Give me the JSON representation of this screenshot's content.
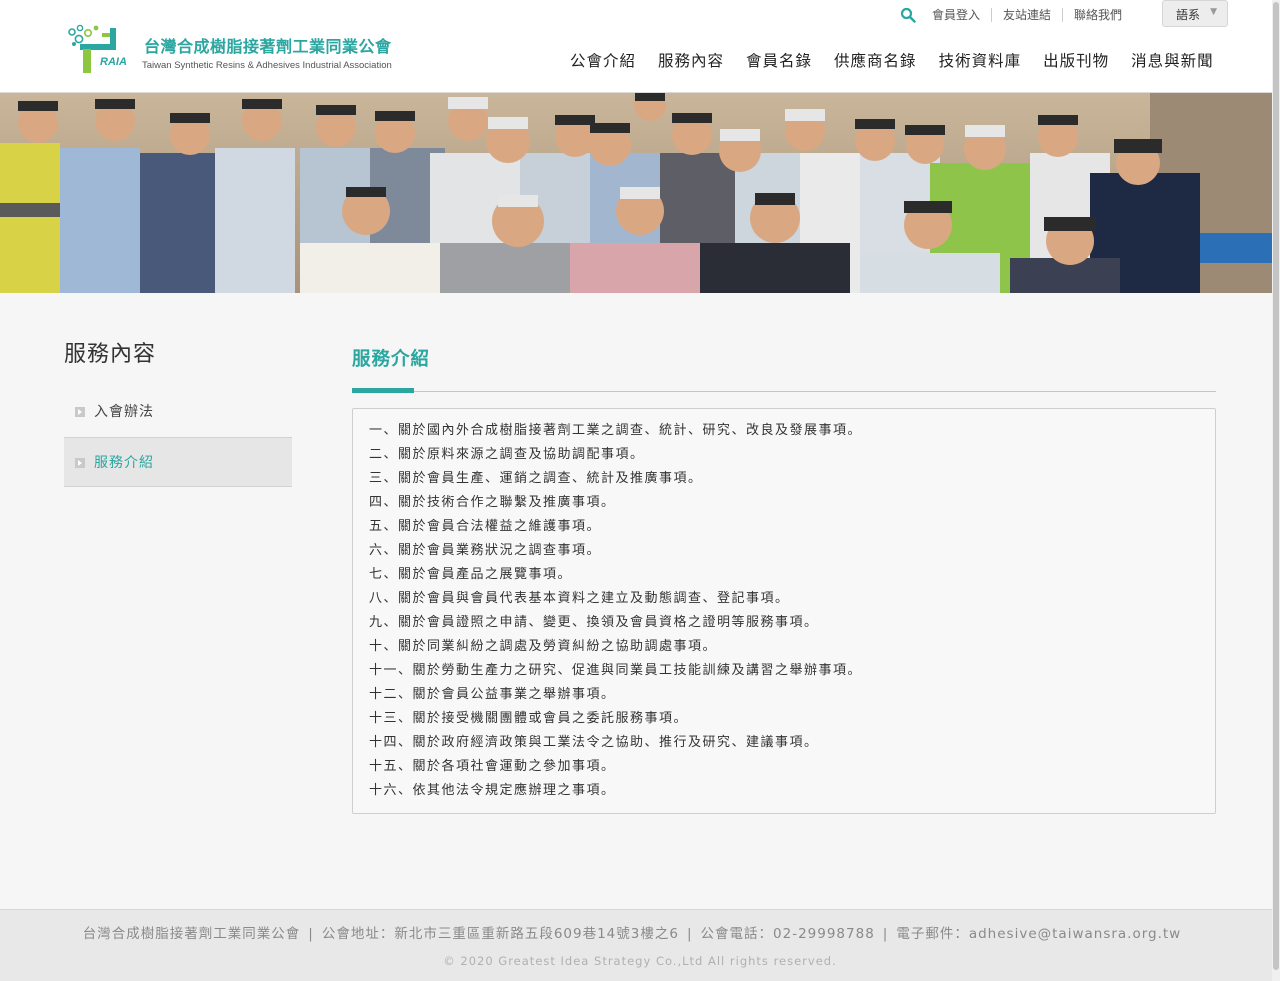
{
  "header": {
    "logo_cn": "台灣合成樹脂接著劑工業同業公會",
    "logo_en": "Taiwan Synthetic Resins & Adhesives Industrial Association",
    "logo_abbr": "RAIA",
    "util_links": [
      "會員登入",
      "友站連結",
      "聯絡我們"
    ],
    "lang_label": "語系",
    "nav": [
      "公會介紹",
      "服務內容",
      "會員名錄",
      "供應商名錄",
      "技術資料庫",
      "出版刊物",
      "消息與新聞"
    ]
  },
  "sidebar": {
    "title": "服務內容",
    "items": [
      {
        "label": "入會辦法",
        "active": false
      },
      {
        "label": "服務介紹",
        "active": true
      }
    ]
  },
  "main": {
    "title": "服務介紹",
    "lines": [
      "一、關於國內外合成樹脂接著劑工業之調查、統計、研究、改良及發展事項。",
      "二、關於原料來源之調查及協助調配事項。",
      "三、關於會員生產、運銷之調查、統計及推廣事項。",
      "四、關於技術合作之聯繫及推廣事項。",
      "五、關於會員合法權益之維護事項。",
      "六、關於會員業務狀況之調查事項。",
      "七、關於會員產品之展覽事項。",
      "八、關於會員與會員代表基本資料之建立及動態調查、登記事項。",
      "九、關於會員證照之申請、變更、換領及會員資格之證明等服務事項。",
      "十、關於同業糾紛之調處及勞資糾紛之協助調處事項。",
      "十一、關於勞動生產力之研究、促進與同業員工技能訓練及講習之舉辦事項。",
      "十二、關於會員公益事業之舉辦事項。",
      "十三、關於接受機關團體或會員之委託服務事項。",
      "十四、關於政府經濟政策與工業法令之協助、推行及研究、建議事項。",
      "十五、關於各項社會運動之參加事項。",
      "十六、依其他法令規定應辦理之事項。"
    ]
  },
  "footer": {
    "org": "台灣合成樹脂接著劑工業同業公會",
    "address": "公會地址：新北市三重區重新路五段609巷14號3樓之6",
    "phone": "公會電話：02-29998788",
    "email": "電子郵件：adhesive@taiwansra.org.tw",
    "copyright": "© 2020 Greatest Idea Strategy Co.,Ltd All rights reserved."
  },
  "colors": {
    "accent": "#2ba6a0",
    "logo_green": "#8dc63f"
  },
  "icons": {
    "search": "search-icon",
    "lang_caret": "chevron-down-icon",
    "bullet": "chevron-right-icon"
  }
}
